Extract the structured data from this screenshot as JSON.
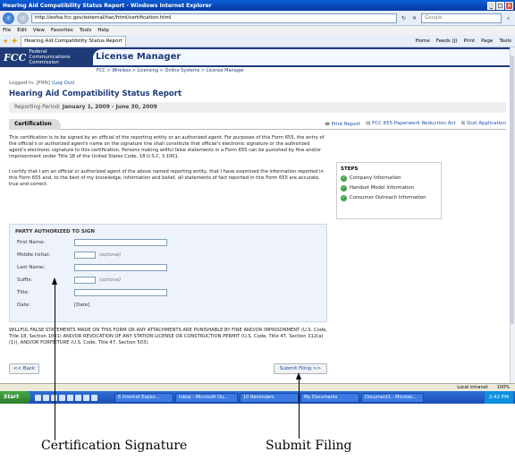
{
  "window": {
    "title": "Hearing Aid Compatibility Status Report - Windows Internet Explorer",
    "url": "http://esfsa.fcc.gov/external/hac/html/certification.html",
    "search_placeholder": "Google",
    "menus": [
      "File",
      "Edit",
      "View",
      "Favorites",
      "Tools",
      "Help"
    ],
    "tab_title": "Hearing Aid Compatibility Status Report",
    "toolbar": [
      "Home",
      "Feeds (J)",
      "Print",
      "Page",
      "Tools"
    ]
  },
  "header": {
    "logo_mark": "FCC",
    "logo_name": [
      "Federal",
      "Communications",
      "Commission"
    ],
    "app_title": "License Manager",
    "breadcrumb": "FCC > Wireless > Licensing > Online Systems > License Manager"
  },
  "page": {
    "logged_in_prefix": "Logged In: [FRN]",
    "logout_label": "(Log Out)",
    "title": "Hearing Aid Compatibility Status Report",
    "period_label": "Reporting Period:",
    "period_value": "January 1, 2009 - June 30, 2009",
    "section_tab": "Certification",
    "links": {
      "print": "Print Report",
      "paperwork": "FCC 655 Paperwork Reduction Act",
      "quit": "Quit Application"
    },
    "para1": "This certification is to be signed by an official of the reporting entity or an authorized agent. For purposes of this Form 655, the entry of the official's or authorized agent's name on the signature line shall constitute that official's electronic signature or the authorized agent's electronic signature to this certification. Persons making willful false statements in a Form 655 can be punished by fine and/or imprisonment under Title 18 of the United States Code, 18 U.S.C. § 1001.",
    "para2": "I certify that I am an official or authorized agent of the above named reporting entity, that I have examined the information reported in this Form 655 and, to the best of my knowledge, information and belief, all statements of fact reported in this Form 655 are accurate, true and correct."
  },
  "steps": {
    "heading": "STEPS",
    "items": [
      "Company Information",
      "Handset Model Information",
      "Consumer Outreach Information"
    ]
  },
  "form": {
    "heading": "PARTY AUTHORIZED TO SIGN",
    "first_name": "First Name:",
    "middle_initial": "Middle Initial:",
    "last_name": "Last Name:",
    "suffix": "Suffix:",
    "title": "Title:",
    "date": "Date:",
    "date_value": "[Date]",
    "optional": "(optional)"
  },
  "warning": "WILLFUL FALSE STATEMENTS MADE ON THIS FORM OR ANY ATTACHMENTS ARE PUNISHABLE BY FINE AND/OR IMPRISONMENT (U.S. Code, Title 18, Section 1001) AND/OR REVOCATION OF ANY STATION LICENSE OR CONSTRUCTION PERMIT (U.S. Code, Title 47, Section 312(a)(1)), AND/OR FORFEITURE (U.S. Code, Title 47, Section 503).",
  "buttons": {
    "back": "<< Back",
    "submit": "Submit Filing >>"
  },
  "status": {
    "zone": "Local intranet",
    "zoom": "100%"
  },
  "taskbar": {
    "start": "Start",
    "items": [
      "6 Internet Explor...",
      "Inbox - Microsoft Ou...",
      "10 Reminders",
      "My Documents",
      "Document1 - Microso..."
    ],
    "clock": "2:42 PM"
  },
  "annotations": {
    "signature": "Certification Signature",
    "submit": "Submit Filing"
  }
}
